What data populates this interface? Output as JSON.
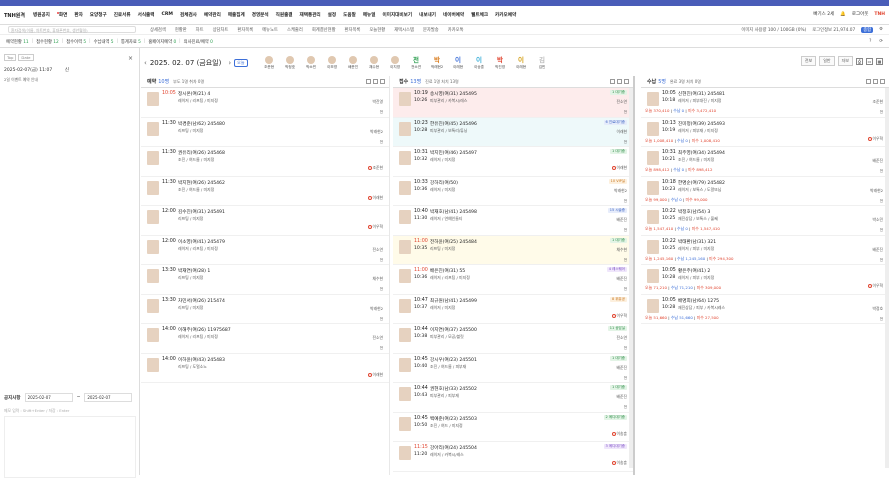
{
  "menu": {
    "logo": "TNH원격",
    "items": [
      "병원공지",
      "화면",
      "환자",
      "요양청구",
      "진료서류",
      "서식출력",
      "CRM",
      "검체검사",
      "예약관리",
      "매출집계",
      "경영분석",
      "직원출결",
      "재택통관리",
      "설정",
      "도움말",
      "메뉴얼",
      "이미지대비보기",
      "내보내기",
      "네이버예약",
      "웰트체크",
      "카카오예약"
    ],
    "right": [
      "빠기스 2세",
      "로그아웃"
    ]
  },
  "toolbar": {
    "search_placeholder": "환자검색(이름, 차트번호, 휴대폰번호, 생년월일)",
    "items": [
      "상세검색",
      "현황판",
      "차트",
      "상담차트",
      "환자목록",
      "메뉴노트",
      "스케줄러",
      "회계결산현황",
      "환자목록",
      "오늘현황",
      "재택시스템",
      "문자발송",
      "카카오톡"
    ],
    "right": [
      "이미지 사용량 100 / 100GB (0%)",
      "로그인정보 21,974.07",
      "종합"
    ]
  },
  "filters": [
    {
      "label": "예약현황",
      "count": "11"
    },
    {
      "label": "접수현황",
      "count": "12"
    },
    {
      "label": "접수이력",
      "count": "5"
    },
    {
      "label": "수납내역",
      "count": "5"
    },
    {
      "label": "통계자료",
      "count": "5"
    },
    {
      "label": "홈페이지예약",
      "count": "0"
    },
    {
      "label": "의사진료/예약",
      "count": "0"
    }
  ],
  "left": {
    "tabs": [
      "Top",
      "Date"
    ],
    "datetime": "2025-02-07(금) 11:07",
    "date_suffix": "신",
    "subtext": "2일 이벤트 예약 안내",
    "notice": {
      "title": "공지사항",
      "from": "2025-02-07",
      "to": "2025-02-07",
      "placeholder": "메모 입력 : Shift+Enter / 저장 : Enter"
    }
  },
  "datebar": {
    "date": "2025. 02. 07 (금요일)",
    "today": "오늘",
    "staff": [
      {
        "name": "조준현",
        "char": ""
      },
      {
        "name": "박정호",
        "char": ""
      },
      {
        "name": "박소민",
        "char": ""
      },
      {
        "name": "이보영",
        "char": ""
      },
      {
        "name": "배준진",
        "char": ""
      },
      {
        "name": "채수현",
        "char": ""
      },
      {
        "name": "이지영",
        "char": ""
      },
      {
        "name": "전소연",
        "char": "전",
        "color": "#2a9d4e"
      },
      {
        "name": "박래현2",
        "char": "박",
        "color": "#d97b1c"
      },
      {
        "name": "이래현",
        "char": "이",
        "color": "#3d6fd8"
      },
      {
        "name": "이송훈",
        "char": "이",
        "color": "#3aaed8"
      },
      {
        "name": "박진영",
        "char": "박",
        "color": "#e0442f"
      },
      {
        "name": "이래현",
        "char": "이",
        "color": "#d4a017"
      },
      {
        "name": "김민",
        "char": "김",
        "color": "#bbb"
      }
    ],
    "views": [
      "전보",
      "일반",
      "자보"
    ]
  },
  "columns": [
    {
      "title": "예약",
      "count": "10명",
      "info": "부도 1명 취차 0명",
      "cards": [
        {
          "time": "10:05",
          "red": true,
          "name": "정시온(여/21) 4",
          "svc": "레이저 / 리프팅 / 미지정",
          "doc": "박진영",
          "stat": "전"
        },
        {
          "time": "11:30",
          "name": "박경준(남/62) 245480",
          "svc": "리프팅 / 미지정",
          "doc": "박래현2",
          "stat": "전"
        },
        {
          "time": "11:30",
          "name": "권유리(여/26) 245468",
          "svc": "조진 / 여드름 / 미지정",
          "rem": "조준현"
        },
        {
          "time": "11:30",
          "name": "박지현(여/26) 245462",
          "svc": "조진 / 여드름 / 미지정",
          "rem": "이래현"
        },
        {
          "time": "12:00",
          "name": "김수진(여/31) 245491",
          "svc": "리프팅 / 미지정",
          "rem": "이우혁"
        },
        {
          "time": "12:00",
          "name": "이소영(여/41) 245479",
          "svc": "레이저 / 리프팅 / 미지정",
          "doc": "전소연",
          "stat": "전"
        },
        {
          "time": "13:30",
          "name": "박재연(여/28) 1",
          "svc": "리프팅 / 미지정",
          "doc": "채수현",
          "stat": "전"
        },
        {
          "time": "13:30",
          "name": "차민서(여/26) 215474",
          "svc": "리프팅 / 미지정",
          "doc": "박래현2",
          "stat": "전"
        },
        {
          "time": "14:00",
          "name": "이해주(여/26) 11975687",
          "svc": "레이저 / 리프팅 / 미지정",
          "doc": "전소연",
          "stat": "전"
        },
        {
          "time": "14:00",
          "name": "이하윤(여/43) 245483",
          "svc": "리프팅 / 도얼소노",
          "rem": "이래현"
        }
      ]
    },
    {
      "title": "접수",
      "count": "13명",
      "info": "진료 1명 처치 13명",
      "cards": [
        {
          "time": "10:19",
          "t2": "10:26",
          "name": "송시영(여/31) 245495",
          "svc": "피부관리 / 카복시/레스",
          "badge": "1 대기중",
          "bc": "",
          "doc": "전소연",
          "stat": "전",
          "hl": true
        },
        {
          "time": "10:23",
          "t2": "10:28",
          "name": "한유진(여/45) 245496",
          "svc": "피부관리 / 보톡리/튜닝",
          "badge": "6 진료대기중",
          "bc": "blue",
          "doc": "이래현",
          "stat": "전",
          "tl": true
        },
        {
          "time": "10:31",
          "t2": "10:32",
          "name": "박지민(여/46) 245497",
          "svc": "레이저 / 미지정",
          "badge": "1 대기중",
          "bc": "",
          "rem": "이래현"
        },
        {
          "time": "10:33",
          "t2": "10:36",
          "name": "강하리(여/50)",
          "svc": "레이저 / 미지정",
          "badge": "10 VIP실",
          "bc": "orange",
          "doc": "박래현2",
          "stat": "전"
        },
        {
          "time": "10:40",
          "t2": "11:30",
          "name": "박재호(남/41) 245498",
          "svc": "레이저 / 연예인들티",
          "badge": "15 시술중",
          "bc": "blue",
          "doc": "배준진",
          "stat": "전"
        },
        {
          "time": "11:00",
          "red": true,
          "t2": "10:35",
          "name": "전하윤(여/25) 245484",
          "svc": "리프팅 / 미지정",
          "badge": "1 대기중",
          "bc": "",
          "doc": "채수현",
          "stat": "전",
          "yl": true
        },
        {
          "time": "11:00",
          "red": true,
          "t2": "10:36",
          "name": "배은진(여/31) 55",
          "svc": "레이저 / 리프팅 / 미지정",
          "badge": "4 레스웨어",
          "bc": "purple",
          "doc": "배준진",
          "stat": "전"
        },
        {
          "time": "10:47",
          "t2": "10:37",
          "name": "최규원(남/41) 245499",
          "svc": "레이저 / 미지정",
          "badge": "8 위유공",
          "bc": "orange",
          "rem": "이우혁"
        },
        {
          "time": "10:44",
          "t2": "10:38",
          "name": "이지연(여/37) 245500",
          "svc": "피부관리 / 모공/블릿",
          "badge": "11 상담실",
          "bc": "",
          "doc": "전소연",
          "stat": "전"
        },
        {
          "time": "10:45",
          "t2": "10:40",
          "name": "강시우(여/23) 245501",
          "svc": "조진 / 여드름 / 피부재",
          "badge": "1 대기중",
          "bc": "",
          "doc": "배준진",
          "stat": "전"
        },
        {
          "time": "10:44",
          "t2": "10:43",
          "name": "권현호(남/33) 245502",
          "svc": "피부관리 / 피부재",
          "badge": "1 대기중",
          "bc": "",
          "doc": "배준진",
          "stat": "전"
        },
        {
          "time": "10:45",
          "t2": "10:50",
          "name": "백예준(여/23) 245503",
          "svc": "조진 / 여드 / 미지정",
          "badge": "2 메디대기중",
          "bc": "",
          "rem": "이송훈"
        },
        {
          "time": "11:15",
          "red": true,
          "t2": "11:20",
          "name": "강아리(여/24) 245504",
          "svc": "레이저 / 카복시/레스",
          "badge": "3 메디대기중",
          "bc": "purple",
          "rem": "이송훈"
        }
      ]
    },
    {
      "title": "수납",
      "count": "5명",
      "info": "완료 3명 처치 0명",
      "cards": [
        {
          "time": "10:05",
          "t2": "10:18",
          "name": "신현진(여/31) 245481",
          "svc": "레이저 / 피부대진 / 미지정",
          "pa": "오늘 370,410",
          "pb": "수납 0",
          "pc": "미수 3,472,410",
          "doc": "조준현",
          "stat": "전"
        },
        {
          "time": "10:13",
          "t2": "10:19",
          "name": "진미정(여/39) 245493",
          "svc": "레이저 / 피부재 / 미지정",
          "pa": "오늘 1,008,410",
          "pb": "수납 0",
          "pc": "미수 1,008,410",
          "rem": "이우혁"
        },
        {
          "time": "10:31",
          "t2": "10:21",
          "name": "최주영(여/34) 245494",
          "svc": "조진 / 여드름 / 미지정",
          "pa": "오늘 898,412",
          "pb": "수납 0",
          "pc": "미수 898,412",
          "doc": "배준진",
          "stat": "전"
        },
        {
          "time": "10:18",
          "t2": "10:23",
          "name": "한명순(여/79) 245482",
          "svc": "레이저 / 보톡스 / 도알또님",
          "pa": "오늘 99,000",
          "pb": "수납 0",
          "pc": "미수 99,000",
          "doc": "박래현2",
          "stat": "전"
        },
        {
          "time": "10:22",
          "t2": "10:25",
          "name": "박정호(남/54) 3",
          "svc": "재진상담 / 보톡스 / 울쎄",
          "pa": "오늘 1,547,410",
          "pb": "수납 0",
          "pc": "미수 1,547,410",
          "doc": "박소민",
          "stat": "전"
        },
        {
          "time": "10:22",
          "t2": "10:25",
          "name": "박태환(남/31) 321",
          "svc": "레이저 / 피부 / 미지정",
          "pa": "오늘 1,245,160",
          "pb": "수납 1,245,160",
          "pc": "미수 294,300",
          "doc": "배준진",
          "stat": "전"
        },
        {
          "time": "10:05",
          "t2": "10:28",
          "name": "황은주(여/41) 2",
          "svc": "레이저 / 피부 / 미지정",
          "pa": "오늘 71,210",
          "pb": "수납 71,210",
          "pc": "미수 309,000",
          "rem": "이우혁"
        },
        {
          "time": "10:05",
          "t2": "10:28",
          "name": "배명희(남/64) 1275",
          "svc": "재진상담 / 피부 / 카복시레스",
          "pa": "오늘 51,660",
          "pb": "수납 51,660",
          "pc": "미수 27,500",
          "doc": "박정호",
          "stat": "전"
        }
      ]
    }
  ]
}
